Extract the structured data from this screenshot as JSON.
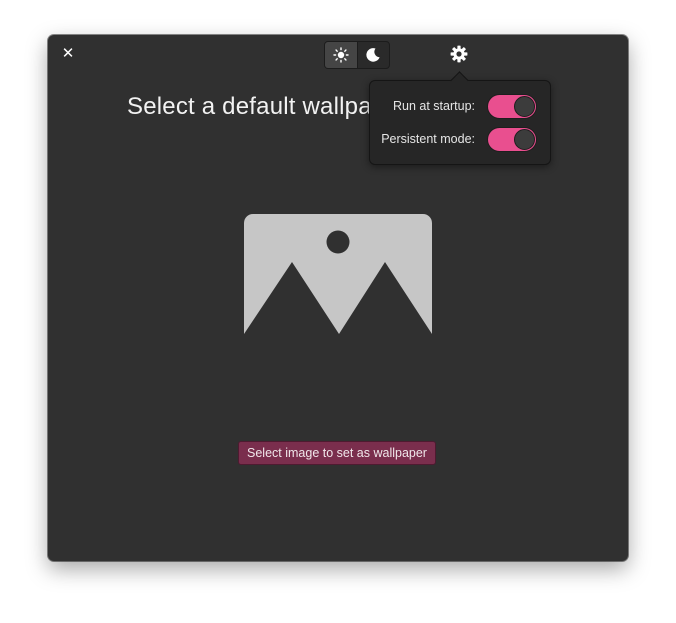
{
  "window": {
    "title": "Select a default wallpaper"
  },
  "header": {
    "close_icon": "close-icon",
    "mode_switch": {
      "light_icon": "sun-icon",
      "dark_icon": "moon-icon",
      "selected": "light"
    },
    "settings_icon": "gear-icon"
  },
  "settings_popover": {
    "rows": [
      {
        "label": "Run at startup:",
        "toggle_on": true
      },
      {
        "label": "Persistent mode:",
        "toggle_on": true
      }
    ]
  },
  "main": {
    "placeholder_icon": "image-placeholder-icon",
    "select_button_label": "Select image to set as wallpaper"
  },
  "colors": {
    "window_bg": "#303030",
    "accent": "#e94f8f",
    "button_bg": "#7a2e4d",
    "placeholder": "#c6c6c6"
  }
}
